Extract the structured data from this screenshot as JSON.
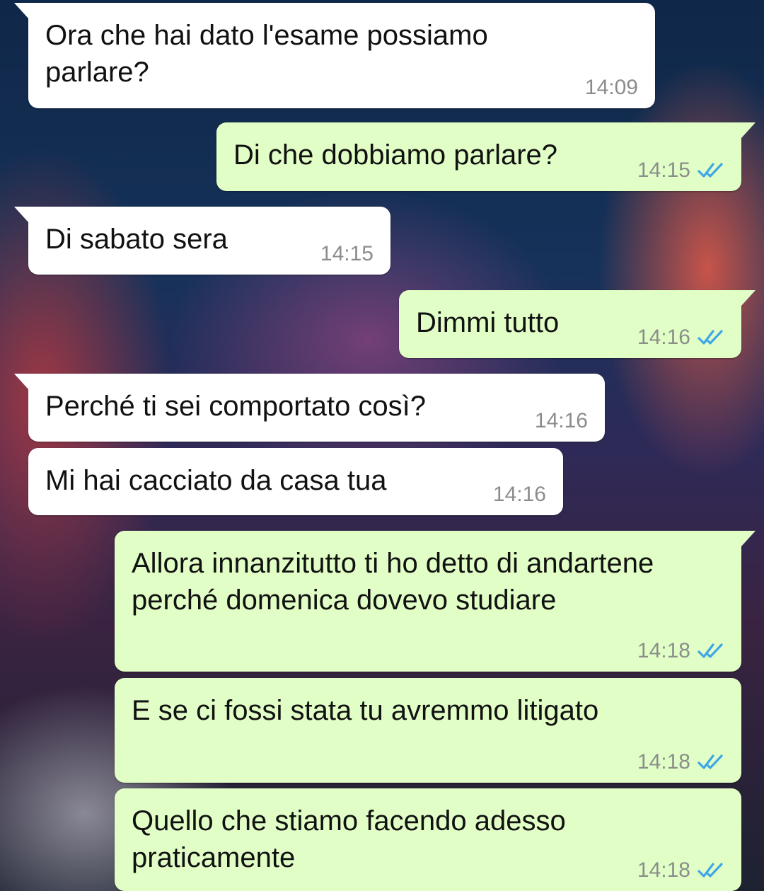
{
  "colors": {
    "incoming_bubble": "#ffffff",
    "outgoing_bubble": "#e1fec6",
    "read_check": "#3ea6e8",
    "timestamp": "#8a8f8a"
  },
  "messages": [
    {
      "direction": "incoming",
      "text": "Ora che hai dato l'esame possiamo\nparlare?",
      "time": "14:09"
    },
    {
      "direction": "outgoing",
      "text": "Di che dobbiamo parlare?",
      "time": "14:15",
      "status": "read-double-check-icon"
    },
    {
      "direction": "incoming",
      "text": "Di sabato sera",
      "time": "14:15"
    },
    {
      "direction": "outgoing",
      "text": "Dimmi tutto",
      "time": "14:16",
      "status": "read-double-check-icon"
    },
    {
      "direction": "incoming",
      "text": "Perché ti sei comportato così?",
      "time": "14:16"
    },
    {
      "direction": "incoming",
      "text": "Mi hai cacciato da casa tua",
      "time": "14:16"
    },
    {
      "direction": "outgoing",
      "text": "Allora innanzitutto ti ho detto di andartene\nperché domenica dovevo studiare",
      "time": "14:18",
      "status": "read-double-check-icon"
    },
    {
      "direction": "outgoing",
      "text": "E se ci fossi stata tu avremmo litigato",
      "time": "14:18",
      "status": "read-double-check-icon"
    },
    {
      "direction": "outgoing",
      "text": "Quello che stiamo facendo adesso\npraticamente",
      "time": "14:18",
      "status": "read-double-check-icon"
    }
  ]
}
